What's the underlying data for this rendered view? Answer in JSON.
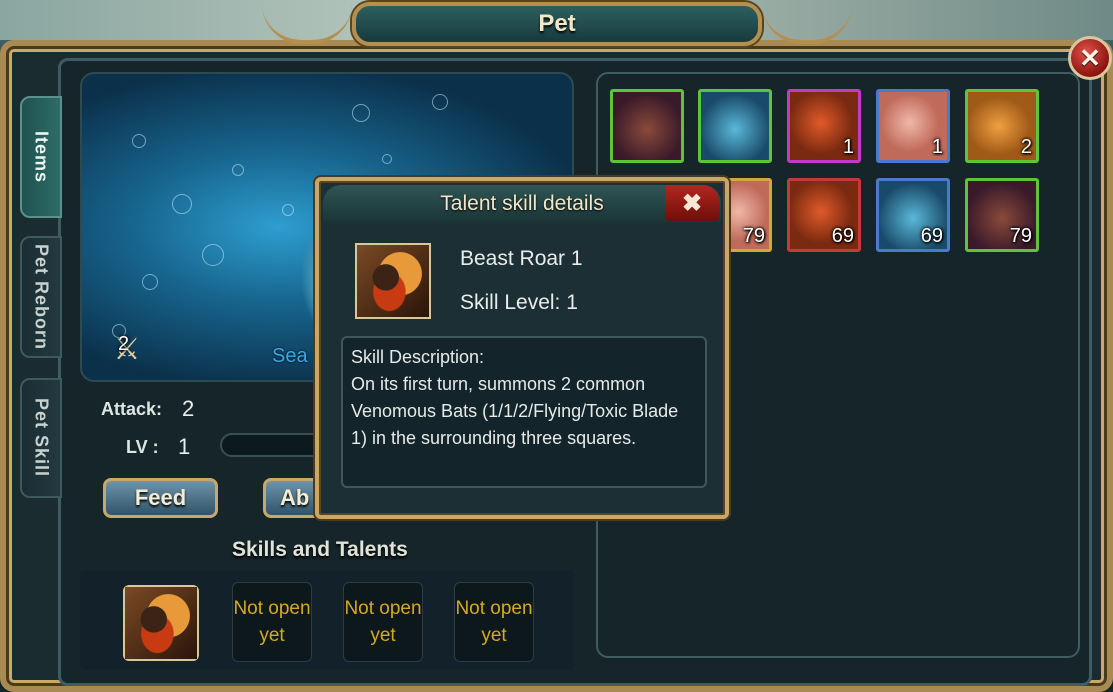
{
  "window": {
    "title": "Pet",
    "close_icon": "close-x-icon"
  },
  "side_tabs": [
    {
      "label": "Items",
      "active": true
    },
    {
      "label": "Pet Reborn",
      "active": false
    },
    {
      "label": "Pet Skill",
      "active": false
    }
  ],
  "pet": {
    "name": "Sea",
    "badge_count": "2",
    "attack_label": "Attack:",
    "attack_value": "2",
    "level_label": "LV :",
    "level_value": "1"
  },
  "buttons": {
    "feed": "Feed",
    "second": "Ab"
  },
  "skills": {
    "title": "Skills and Talents",
    "slots": [
      {
        "filled": true,
        "label": ""
      },
      {
        "filled": false,
        "label": "Not open yet"
      },
      {
        "filled": false,
        "label": "Not open yet"
      },
      {
        "filled": false,
        "label": "Not open yet"
      }
    ]
  },
  "inventory": {
    "items": [
      {
        "icon": "boar-icon",
        "count": "",
        "border": "#5ec43a"
      },
      {
        "icon": "sea-dragon-icon",
        "count": "",
        "border": "#5ec43a"
      },
      {
        "icon": "shrimp-icon",
        "count": "1",
        "border": "#c43ac4"
      },
      {
        "icon": "meat-icon",
        "count": "1",
        "border": "#4a7acc"
      },
      {
        "icon": "bread-icon",
        "count": "2",
        "border": "#5ec43a"
      },
      {
        "icon": "meat-icon",
        "count": "79",
        "border": "#d4a73a"
      },
      {
        "icon": "shrimp-icon",
        "count": "69",
        "border": "#c43a3a"
      },
      {
        "icon": "sea-dragon-icon",
        "count": "69",
        "border": "#4a7acc"
      },
      {
        "icon": "boar-icon",
        "count": "79",
        "border": "#5ec43a"
      }
    ]
  },
  "popup": {
    "title": "Talent skill details",
    "close": "✖",
    "skill_name": "Beast Roar 1",
    "skill_level": "Skill Level: 1",
    "desc_label": "Skill Description:",
    "desc_text": "On its first turn, summons 2 common Venomous Bats (1/1/2/Flying/Toxic Blade 1) in the surrounding three squares."
  }
}
